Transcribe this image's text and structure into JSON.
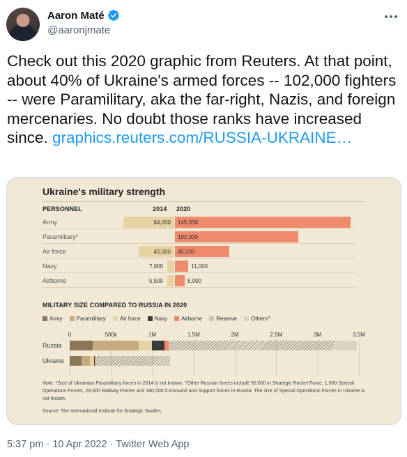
{
  "author": {
    "display_name": "Aaron Maté",
    "handle": "@aaronjmate",
    "verified": true,
    "avatar_icon": "avatar-photo",
    "more_icon": "more-options-icon"
  },
  "tweet": {
    "text": "Check out this 2020 graphic from Reuters. At that point, about 40% of Ukraine's armed forces -- 102,000 fighters -- were Paramilitary, aka the far-right, Nazis, and foreign mercenaries. No doubt those ranks have increased since. ",
    "link_text": "graphics.reuters.com/RUSSIA-UKRAINE…"
  },
  "meta": {
    "time": "5:37 pm",
    "sep1": "·",
    "date": "10 Apr 2022",
    "sep2": "·",
    "app": "Twitter Web App"
  },
  "colors": {
    "accent": "#1d9bf0",
    "verified": "#1d9bf0",
    "chart_bg": "#f1e8d6",
    "army": "#8a7658",
    "paramilitary": "#c7ab80",
    "airforce": "#e6d3a3",
    "navy": "#3a3a3a",
    "airborne": "#ef8a6c"
  },
  "chart_data": [
    {
      "type": "bar",
      "title": "Ukraine's military strength",
      "section": "PERSONNEL",
      "categories": [
        "Army",
        "Paramilitary*",
        "Air force",
        "Navy",
        "Airborne"
      ],
      "series": [
        {
          "name": "2014",
          "values": [
            64000,
            null,
            45000,
            7000,
            5500
          ],
          "labels": [
            "64,000",
            "",
            "45,000",
            "7,000",
            "5,500"
          ]
        },
        {
          "name": "2020",
          "values": [
            145000,
            102000,
            45000,
            11000,
            8000
          ],
          "labels": [
            "145,000",
            "102,000",
            "45,000",
            "11,000",
            "8,000"
          ]
        }
      ]
    },
    {
      "type": "bar",
      "orientation": "horizontal-stacked",
      "section": "MILITARY SIZE COMPARED TO RUSSIA IN 2020",
      "categories": [
        "Russia",
        "Ukraine"
      ],
      "xticks": [
        "0",
        "500k",
        "1M",
        "1.5M",
        "2M",
        "2.5M",
        "3M",
        "3.5M"
      ],
      "xlim": [
        0,
        3500000
      ],
      "legend": [
        "Army",
        "Paramilitary",
        "Air force",
        "Navy",
        "Airborne",
        "Reserve",
        "Others^"
      ],
      "series": [
        {
          "name": "Army",
          "values": [
            280000,
            145000
          ]
        },
        {
          "name": "Paramilitary",
          "values": [
            554000,
            102000
          ]
        },
        {
          "name": "Air force",
          "values": [
            165000,
            45000
          ]
        },
        {
          "name": "Navy",
          "values": [
            150000,
            11000
          ]
        },
        {
          "name": "Airborne",
          "values": [
            45000,
            8000
          ]
        },
        {
          "name": "Reserve",
          "values": [
            2000000,
            900000
          ]
        },
        {
          "name": "Others^",
          "values": [
            280000,
            0
          ]
        }
      ],
      "note": "Note: *Size of Ukrainian Paramilitary forces in 2014 is not known. ^Other Russian forces include 50,000 in Strategic Rocket Force, 1,000 Special Operations Forces, 29,000 Railway Forces and 180,000 Command and Support forces in Russia. The size of Special Operations Forces in Ukraine is not known.",
      "source": "Source: The International Institute for Strategic Studies"
    }
  ],
  "chart_labels": {
    "col_2014": "2014",
    "col_2020": "2020"
  }
}
